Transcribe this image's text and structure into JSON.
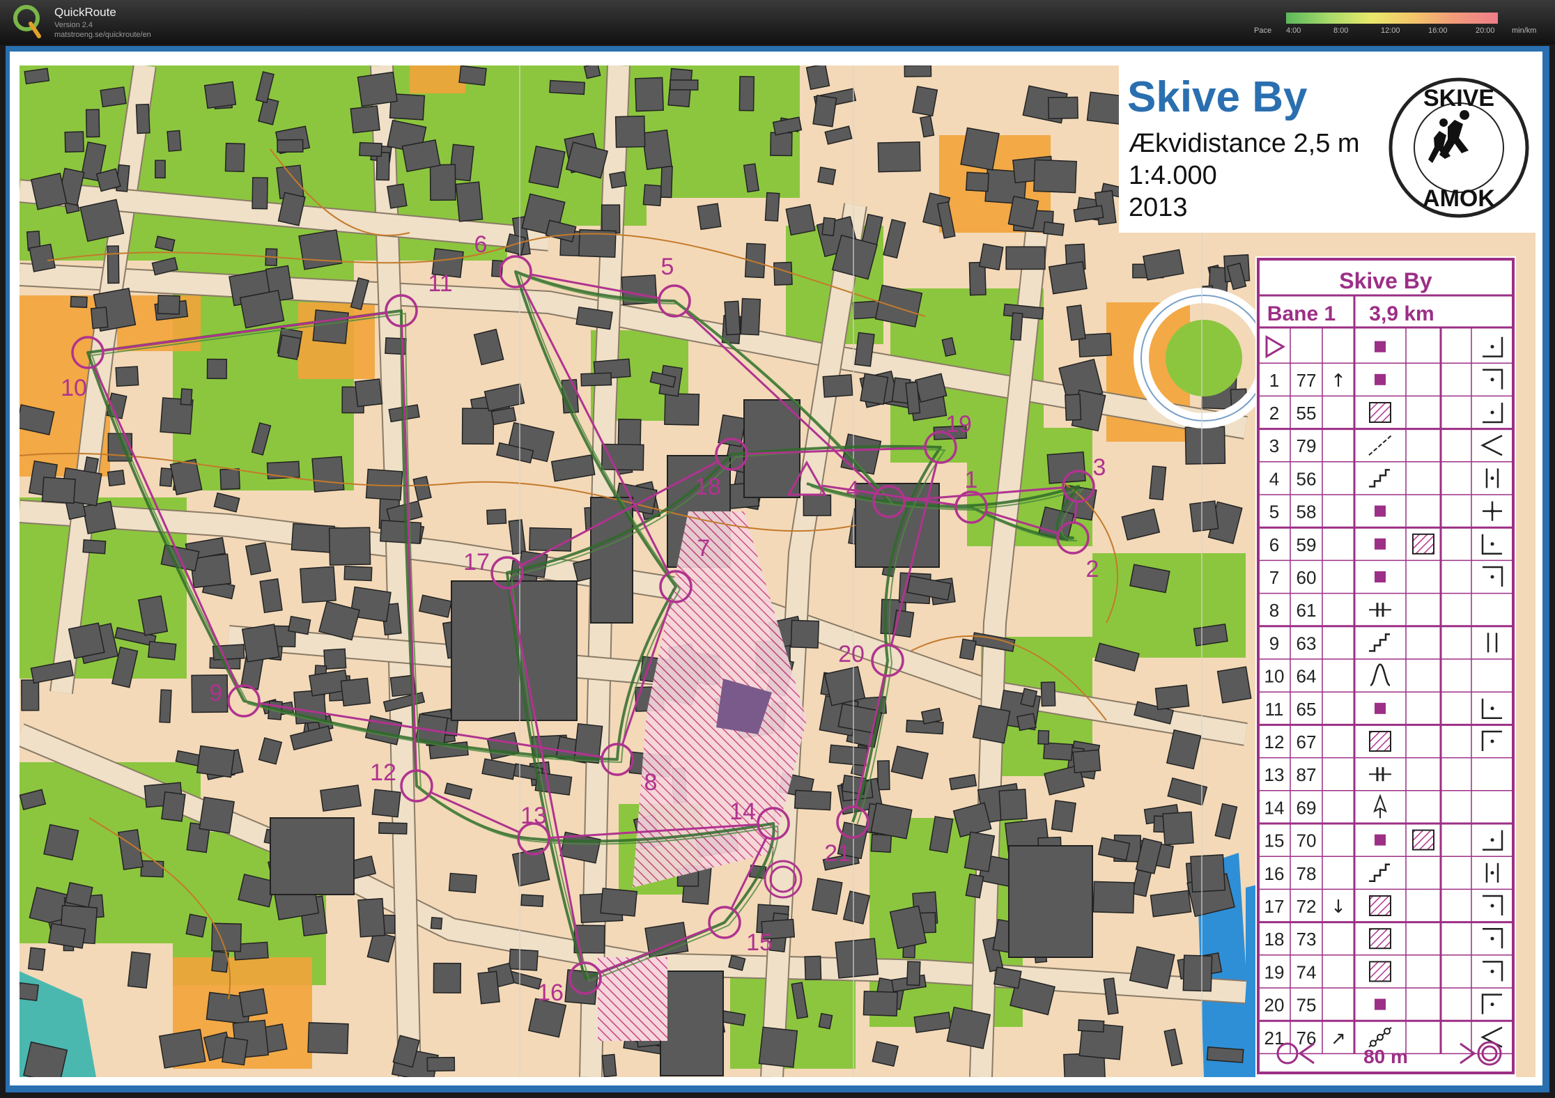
{
  "app": {
    "title": "QuickRoute",
    "version": "Version 2.4",
    "url": "matstroeng.se/quickroute/en"
  },
  "pace_legend": {
    "label": "Pace",
    "ticks": [
      "4:00",
      "8:00",
      "12:00",
      "16:00",
      "20:00"
    ],
    "unit": "min/km"
  },
  "map": {
    "title": "Skive By",
    "contour": "Ækvidistance 2,5 m",
    "scale": "1:4.000",
    "year": "2013",
    "club_logo_top": "SKIVE",
    "club_logo_bottom": "AMOK"
  },
  "description_sheet": {
    "title": "Skive By",
    "course": "Bane 1",
    "length": "3,9 km",
    "footer_distance": "80 m",
    "rows": [
      {
        "num": "",
        "code": "",
        "arrow": "",
        "feature": "square",
        "feature2": "",
        "pos": "corner-se"
      },
      {
        "num": "1",
        "code": "77",
        "arrow": "↑",
        "feature": "square",
        "feature2": "",
        "pos": "corner-ne"
      },
      {
        "num": "2",
        "code": "55",
        "arrow": "",
        "feature": "hatch",
        "feature2": "",
        "pos": "corner-se"
      },
      {
        "num": "3",
        "code": "79",
        "arrow": "",
        "feature": "slash",
        "feature2": "",
        "pos": "angle"
      },
      {
        "num": "4",
        "code": "56",
        "arrow": "",
        "feature": "stairs",
        "feature2": "",
        "pos": "double"
      },
      {
        "num": "5",
        "code": "58",
        "arrow": "",
        "feature": "square",
        "feature2": "",
        "pos": "middle"
      },
      {
        "num": "6",
        "code": "59",
        "arrow": "",
        "feature": "square",
        "feature2": "hatch",
        "pos": "corner-sw"
      },
      {
        "num": "7",
        "code": "60",
        "arrow": "",
        "feature": "square",
        "feature2": "",
        "pos": "corner-ne"
      },
      {
        "num": "8",
        "code": "61",
        "arrow": "",
        "feature": "passage",
        "feature2": "",
        "pos": "none"
      },
      {
        "num": "9",
        "code": "63",
        "arrow": "",
        "feature": "stairs",
        "feature2": "",
        "pos": "bars"
      },
      {
        "num": "10",
        "code": "64",
        "arrow": "",
        "feature": "arch",
        "feature2": "",
        "pos": "none"
      },
      {
        "num": "11",
        "code": "65",
        "arrow": "",
        "feature": "square",
        "feature2": "",
        "pos": "corner-sw"
      },
      {
        "num": "12",
        "code": "67",
        "arrow": "",
        "feature": "hatch",
        "feature2": "",
        "pos": "corner-nw"
      },
      {
        "num": "13",
        "code": "87",
        "arrow": "",
        "feature": "passage",
        "feature2": "",
        "pos": "none"
      },
      {
        "num": "14",
        "code": "69",
        "arrow": "",
        "feature": "arrow-up",
        "feature2": "",
        "pos": "none"
      },
      {
        "num": "15",
        "code": "70",
        "arrow": "",
        "feature": "square",
        "feature2": "hatch",
        "pos": "corner-se"
      },
      {
        "num": "16",
        "code": "78",
        "arrow": "",
        "feature": "stairs",
        "feature2": "",
        "pos": "double"
      },
      {
        "num": "17",
        "code": "72",
        "arrow": "↓",
        "feature": "hatch",
        "feature2": "",
        "pos": "corner-ne"
      },
      {
        "num": "18",
        "code": "73",
        "arrow": "",
        "feature": "hatch",
        "feature2": "",
        "pos": "corner-ne"
      },
      {
        "num": "19",
        "code": "74",
        "arrow": "",
        "feature": "hatch",
        "feature2": "",
        "pos": "corner-ne"
      },
      {
        "num": "20",
        "code": "75",
        "arrow": "",
        "feature": "square",
        "feature2": "",
        "pos": "corner-nw"
      },
      {
        "num": "21",
        "code": "76",
        "arrow": "↗",
        "feature": "chain",
        "feature2": "",
        "pos": "angle"
      }
    ]
  },
  "controls": [
    {
      "label": "1"
    },
    {
      "label": "2"
    },
    {
      "label": "3"
    },
    {
      "label": "4"
    },
    {
      "label": "5"
    },
    {
      "label": "6"
    },
    {
      "label": "7"
    },
    {
      "label": "8"
    },
    {
      "label": "9"
    },
    {
      "label": "10"
    },
    {
      "label": "11"
    },
    {
      "label": "12"
    },
    {
      "label": "13"
    },
    {
      "label": "14"
    },
    {
      "label": "15"
    },
    {
      "label": "16"
    },
    {
      "label": "17"
    },
    {
      "label": "18"
    },
    {
      "label": "19"
    },
    {
      "label": "20"
    },
    {
      "label": "21"
    }
  ],
  "colors": {
    "course": "#b0338f",
    "route": "#2f6b2a",
    "green": "#8cc63f",
    "paved": "#f3d9b8",
    "building": "#5a5a5a",
    "open": "#f2a33a",
    "road": "#efe0c7",
    "frame": "#2a6fb0"
  }
}
